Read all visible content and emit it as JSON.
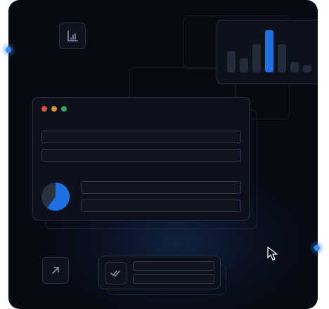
{
  "window": {
    "controls": [
      "close",
      "minimize",
      "maximize"
    ]
  },
  "colors": {
    "accent": "#1f6fe5",
    "close": "#e0532d",
    "minimize": "#e28a24",
    "maximize": "#2fa84f",
    "bar_muted": "#252c39"
  },
  "icons": {
    "chart": "bar-chart-icon",
    "arrow": "arrow-up-right-icon",
    "check": "double-check-icon",
    "cursor": "mouse-pointer-icon"
  },
  "bar_chart": {
    "values": [
      3,
      2,
      4,
      6,
      4,
      1.5,
      1
    ],
    "highlight_index": 3
  },
  "pie": {
    "accent_fraction": 0.6
  }
}
